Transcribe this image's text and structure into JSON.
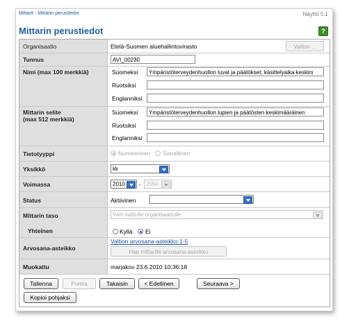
{
  "header": {
    "breadcrumb": "Mittarit - Mittarin perustiedot",
    "view_id": "Näyttö 5.1",
    "title": "Mittarin perustiedot",
    "help_label": "?"
  },
  "form": {
    "organisaatio": {
      "label": "Organisaatio",
      "value": "Etelä-Suomen aluehallintovirasto",
      "button": "Valitse ..."
    },
    "tunnus": {
      "label": "Tunnus",
      "value": "AVI_00230"
    },
    "nimi": {
      "label": "Nimi   (max 100 merkkiä)",
      "languages": [
        "Suomeksi",
        "Ruotsiksi",
        "Englanniksi"
      ],
      "values": [
        "Ympäristöterveydenhuollon luvat ja päätökset, käsittelyaika keskim",
        "",
        ""
      ]
    },
    "selite": {
      "label_line1": "Mittarin selite",
      "label_line2": "(max 512 merkkiä)",
      "languages": [
        "Suomeksi",
        "Ruotsiksi",
        "Englanniksi"
      ],
      "values": [
        "Ympäristöterveydenhuollon lupien ja päätösten keskimääräinen",
        "",
        ""
      ]
    },
    "tietotyyppi": {
      "label": "Tietotyyppi",
      "options": [
        "Numeerinen",
        "Sanallinen"
      ],
      "selected": "Numeerinen"
    },
    "yksikko": {
      "label": "Yksikkö",
      "value": "kk"
    },
    "voimassa": {
      "label": "Voimassa",
      "from": "2010",
      "separator": "-",
      "to": "2050"
    },
    "status": {
      "label": "Status",
      "value": "Aktiivinen"
    },
    "mittarin_taso": {
      "label": "Mittarin taso",
      "value": "Vain valitulle organisaatiolle"
    },
    "yhteinen": {
      "label": "Yhteinen",
      "options": [
        "Kyllä",
        "Ei"
      ],
      "selected": "Ei"
    },
    "arvosana": {
      "label": "Arvosana-asteikko",
      "link": "Valtion arvosana-asteikko 1-5",
      "button": "Hae mittarille arvosana-asteikko"
    },
    "muokattu": {
      "label": "Muokattu",
      "value": "marjakov 23.6.2010 10:36:18"
    }
  },
  "actions": {
    "save": "Tallenna",
    "delete": "Poista",
    "back": "Takaisin",
    "previous": "< Edellinen",
    "next": "Seuraava >",
    "copy_template": "Kopioi pohjaksi"
  },
  "colors": {
    "title": "#1f5e9c",
    "label_bg": "#dfdfdf",
    "help_bg": "#3d8e2b",
    "dropdown_arrow": "#3a6fc0"
  }
}
